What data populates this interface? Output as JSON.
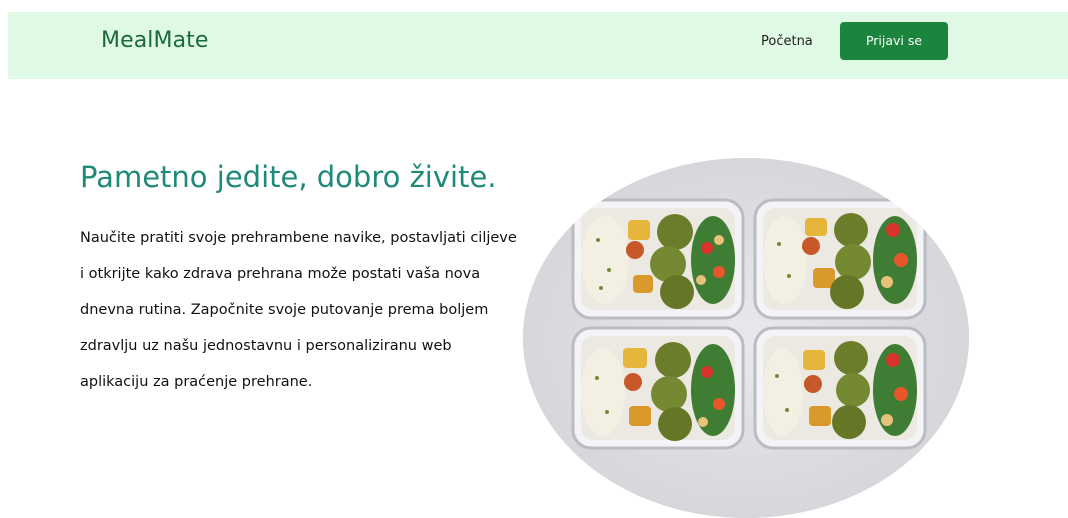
{
  "header": {
    "brand": "MealMate",
    "nav_home": "Početna",
    "login_button": "Prijavi se"
  },
  "hero": {
    "title": "Pametno jedite, dobro živite.",
    "text": "Naučite pratiti svoje prehrambene navike, postavljati ciljeve i otkrijte kako zdrava prehrana može postati vaša nova dnevna rutina. Započnite svoje putovanje prema boljem zdravlju uz našu jednostavnu i personaliziranu web aplikaciju za praćenje prehrane."
  },
  "image": {
    "subject": "meal-prep-containers"
  },
  "colors": {
    "header_bg": "#dff9e4",
    "brand": "#1a6b35",
    "button_bg": "#1b853d",
    "title": "#1f8a7a"
  }
}
